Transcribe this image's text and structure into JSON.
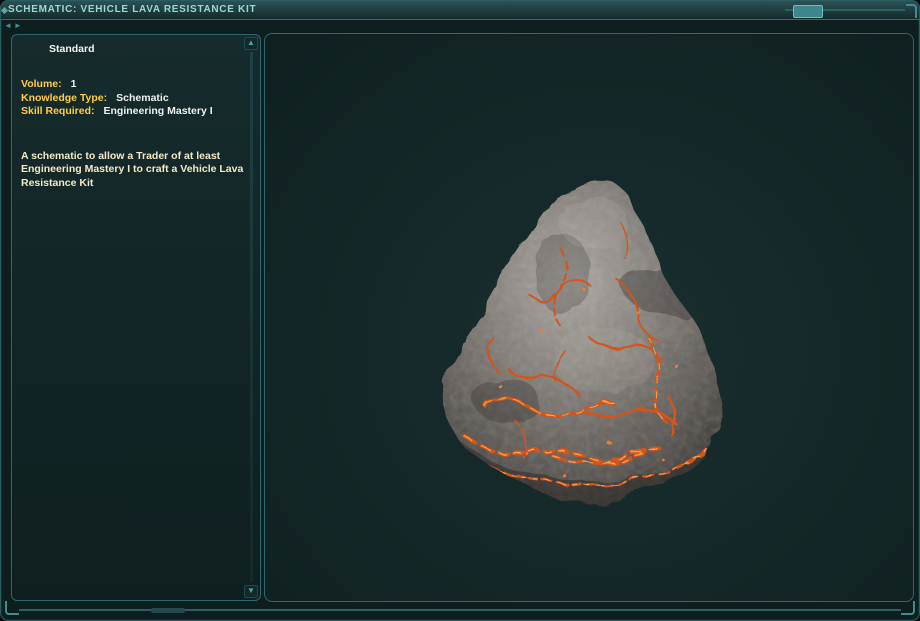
{
  "window": {
    "title": "SCHEMATIC: VEHICLE LAVA RESISTANCE KIT"
  },
  "info_panel": {
    "header": "Standard",
    "fields": [
      {
        "label": "Volume:",
        "value": "1"
      },
      {
        "label": "Knowledge Type:",
        "value": "Schematic"
      },
      {
        "label": "Skill Required:",
        "value": "Engineering Mastery I"
      }
    ],
    "description": "A schematic to allow a Trader of at least Engineering Mastery I to craft a Vehicle Lava Resistance Kit"
  },
  "icons": {
    "scroll_up": "▲",
    "scroll_down": "▼",
    "nav_back": "◄",
    "nav_forward": "►"
  },
  "colors": {
    "accent_teal": "#3f8d92",
    "title_text": "#9cd9ce",
    "label_yellow": "#ffce3e",
    "value_white": "#edf2ee",
    "description_cream": "#f3e9c4",
    "lava_orange": "#ff7a22",
    "rock_gray": "#7d7a76",
    "background": "#0e1d1e"
  }
}
